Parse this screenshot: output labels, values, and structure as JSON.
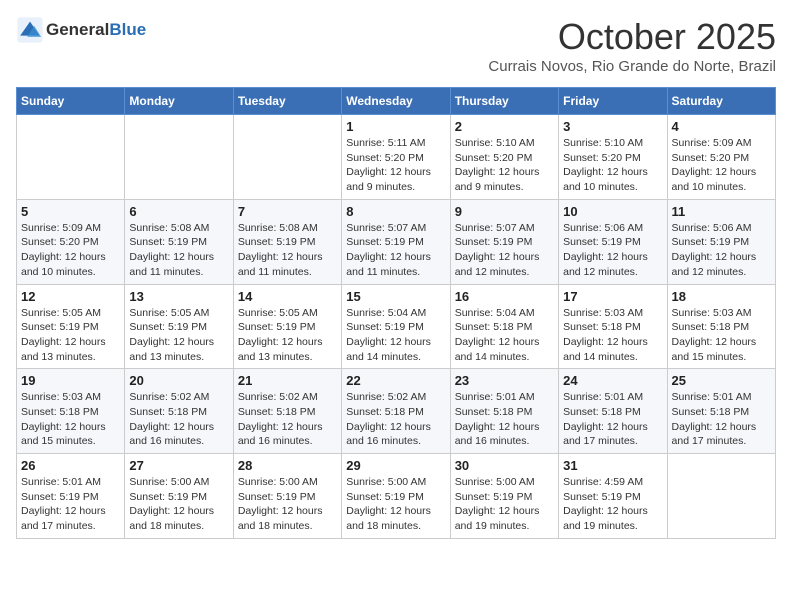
{
  "header": {
    "logo_general": "General",
    "logo_blue": "Blue",
    "month": "October 2025",
    "location": "Currais Novos, Rio Grande do Norte, Brazil"
  },
  "weekdays": [
    "Sunday",
    "Monday",
    "Tuesday",
    "Wednesday",
    "Thursday",
    "Friday",
    "Saturday"
  ],
  "weeks": [
    [
      {
        "day": "",
        "info": ""
      },
      {
        "day": "",
        "info": ""
      },
      {
        "day": "",
        "info": ""
      },
      {
        "day": "1",
        "info": "Sunrise: 5:11 AM\nSunset: 5:20 PM\nDaylight: 12 hours and 9 minutes."
      },
      {
        "day": "2",
        "info": "Sunrise: 5:10 AM\nSunset: 5:20 PM\nDaylight: 12 hours and 9 minutes."
      },
      {
        "day": "3",
        "info": "Sunrise: 5:10 AM\nSunset: 5:20 PM\nDaylight: 12 hours and 10 minutes."
      },
      {
        "day": "4",
        "info": "Sunrise: 5:09 AM\nSunset: 5:20 PM\nDaylight: 12 hours and 10 minutes."
      }
    ],
    [
      {
        "day": "5",
        "info": "Sunrise: 5:09 AM\nSunset: 5:20 PM\nDaylight: 12 hours and 10 minutes."
      },
      {
        "day": "6",
        "info": "Sunrise: 5:08 AM\nSunset: 5:19 PM\nDaylight: 12 hours and 11 minutes."
      },
      {
        "day": "7",
        "info": "Sunrise: 5:08 AM\nSunset: 5:19 PM\nDaylight: 12 hours and 11 minutes."
      },
      {
        "day": "8",
        "info": "Sunrise: 5:07 AM\nSunset: 5:19 PM\nDaylight: 12 hours and 11 minutes."
      },
      {
        "day": "9",
        "info": "Sunrise: 5:07 AM\nSunset: 5:19 PM\nDaylight: 12 hours and 12 minutes."
      },
      {
        "day": "10",
        "info": "Sunrise: 5:06 AM\nSunset: 5:19 PM\nDaylight: 12 hours and 12 minutes."
      },
      {
        "day": "11",
        "info": "Sunrise: 5:06 AM\nSunset: 5:19 PM\nDaylight: 12 hours and 12 minutes."
      }
    ],
    [
      {
        "day": "12",
        "info": "Sunrise: 5:05 AM\nSunset: 5:19 PM\nDaylight: 12 hours and 13 minutes."
      },
      {
        "day": "13",
        "info": "Sunrise: 5:05 AM\nSunset: 5:19 PM\nDaylight: 12 hours and 13 minutes."
      },
      {
        "day": "14",
        "info": "Sunrise: 5:05 AM\nSunset: 5:19 PM\nDaylight: 12 hours and 13 minutes."
      },
      {
        "day": "15",
        "info": "Sunrise: 5:04 AM\nSunset: 5:19 PM\nDaylight: 12 hours and 14 minutes."
      },
      {
        "day": "16",
        "info": "Sunrise: 5:04 AM\nSunset: 5:18 PM\nDaylight: 12 hours and 14 minutes."
      },
      {
        "day": "17",
        "info": "Sunrise: 5:03 AM\nSunset: 5:18 PM\nDaylight: 12 hours and 14 minutes."
      },
      {
        "day": "18",
        "info": "Sunrise: 5:03 AM\nSunset: 5:18 PM\nDaylight: 12 hours and 15 minutes."
      }
    ],
    [
      {
        "day": "19",
        "info": "Sunrise: 5:03 AM\nSunset: 5:18 PM\nDaylight: 12 hours and 15 minutes."
      },
      {
        "day": "20",
        "info": "Sunrise: 5:02 AM\nSunset: 5:18 PM\nDaylight: 12 hours and 16 minutes."
      },
      {
        "day": "21",
        "info": "Sunrise: 5:02 AM\nSunset: 5:18 PM\nDaylight: 12 hours and 16 minutes."
      },
      {
        "day": "22",
        "info": "Sunrise: 5:02 AM\nSunset: 5:18 PM\nDaylight: 12 hours and 16 minutes."
      },
      {
        "day": "23",
        "info": "Sunrise: 5:01 AM\nSunset: 5:18 PM\nDaylight: 12 hours and 16 minutes."
      },
      {
        "day": "24",
        "info": "Sunrise: 5:01 AM\nSunset: 5:18 PM\nDaylight: 12 hours and 17 minutes."
      },
      {
        "day": "25",
        "info": "Sunrise: 5:01 AM\nSunset: 5:18 PM\nDaylight: 12 hours and 17 minutes."
      }
    ],
    [
      {
        "day": "26",
        "info": "Sunrise: 5:01 AM\nSunset: 5:19 PM\nDaylight: 12 hours and 17 minutes."
      },
      {
        "day": "27",
        "info": "Sunrise: 5:00 AM\nSunset: 5:19 PM\nDaylight: 12 hours and 18 minutes."
      },
      {
        "day": "28",
        "info": "Sunrise: 5:00 AM\nSunset: 5:19 PM\nDaylight: 12 hours and 18 minutes."
      },
      {
        "day": "29",
        "info": "Sunrise: 5:00 AM\nSunset: 5:19 PM\nDaylight: 12 hours and 18 minutes."
      },
      {
        "day": "30",
        "info": "Sunrise: 5:00 AM\nSunset: 5:19 PM\nDaylight: 12 hours and 19 minutes."
      },
      {
        "day": "31",
        "info": "Sunrise: 4:59 AM\nSunset: 5:19 PM\nDaylight: 12 hours and 19 minutes."
      },
      {
        "day": "",
        "info": ""
      }
    ]
  ]
}
